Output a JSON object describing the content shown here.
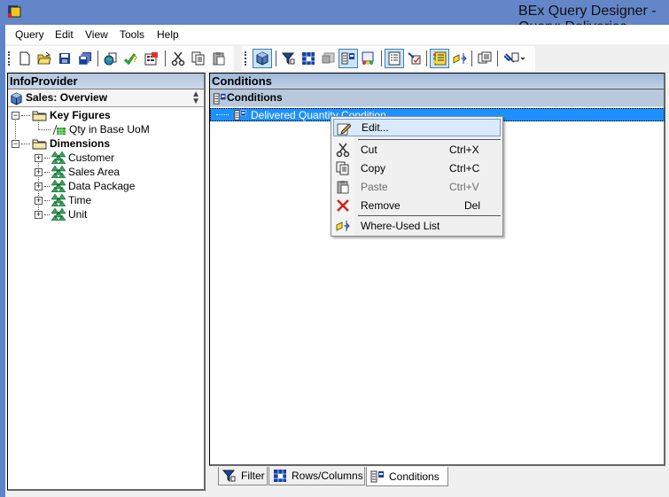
{
  "window": {
    "title": "BEx Query Designer - Query: Deliveries Report",
    "icon": "app-icon"
  },
  "menubar": {
    "items": [
      "Query",
      "Edit",
      "View",
      "Tools",
      "Help"
    ]
  },
  "toolbar1": {
    "buttons": [
      {
        "name": "new-query",
        "icon": "new-document-icon"
      },
      {
        "name": "open-query",
        "icon": "open-folder-icon"
      },
      {
        "name": "save-query",
        "icon": "save-icon"
      },
      {
        "name": "save-all",
        "icon": "save-all-icon"
      },
      {
        "name": "publish",
        "icon": "publish-web-icon"
      },
      {
        "name": "check-query",
        "icon": "check-icon"
      },
      {
        "name": "query-properties",
        "icon": "properties-icon"
      },
      {
        "name": "cut",
        "icon": "cut-icon"
      },
      {
        "name": "copy",
        "icon": "copy-icon"
      },
      {
        "name": "paste",
        "icon": "paste-icon"
      }
    ]
  },
  "toolbar2": {
    "buttons": [
      {
        "name": "infoprovider",
        "icon": "cube-icon",
        "active": true
      },
      {
        "name": "filter",
        "icon": "filter-icon",
        "active": false
      },
      {
        "name": "rows-columns",
        "icon": "grid-icon",
        "active": false
      },
      {
        "name": "cells",
        "icon": "cells-icon",
        "active": false
      },
      {
        "name": "conditions",
        "icon": "conditions-icon",
        "active": true
      },
      {
        "name": "exceptions",
        "icon": "exceptions-icon",
        "active": false
      },
      {
        "name": "properties",
        "icon": "properties-list-icon",
        "active": true
      },
      {
        "name": "tasks",
        "icon": "tasks-icon",
        "active": false
      },
      {
        "name": "messages",
        "icon": "messages-icon",
        "active": true
      },
      {
        "name": "where-used",
        "icon": "where-used-icon",
        "active": false
      },
      {
        "name": "documents",
        "icon": "documents-icon",
        "active": false
      },
      {
        "name": "tools",
        "icon": "wrench-icon",
        "active": false
      }
    ]
  },
  "left_pane": {
    "header": "InfoProvider",
    "provider": "Sales: Overview",
    "tree": [
      {
        "label": "Key Figures",
        "type": "folder",
        "expanded": true,
        "children": [
          {
            "label": "Qty in Base UoM",
            "type": "key-figure"
          }
        ]
      },
      {
        "label": "Dimensions",
        "type": "folder",
        "expanded": true,
        "children": [
          {
            "label": "Customer",
            "type": "dimension"
          },
          {
            "label": "Sales Area",
            "type": "dimension"
          },
          {
            "label": "Data Package",
            "type": "dimension"
          },
          {
            "label": "Time",
            "type": "dimension"
          },
          {
            "label": "Unit",
            "type": "dimension"
          }
        ]
      }
    ]
  },
  "right_pane": {
    "header": "Conditions",
    "group_label": "Conditions",
    "selected_item": "Delivered Quantity Condition"
  },
  "context_menu": {
    "items": [
      {
        "label": "Edit...",
        "shortcut": "",
        "icon": "edit-pencil-icon",
        "highlighted": true,
        "disabled": false
      },
      {
        "label": "Cut",
        "shortcut": "Ctrl+X",
        "icon": "cut-icon",
        "highlighted": false,
        "disabled": false
      },
      {
        "label": "Copy",
        "shortcut": "Ctrl+C",
        "icon": "copy-icon",
        "highlighted": false,
        "disabled": false
      },
      {
        "label": "Paste",
        "shortcut": "Ctrl+V",
        "icon": "paste-icon",
        "highlighted": false,
        "disabled": true
      },
      {
        "label": "Remove",
        "shortcut": "Del",
        "icon": "remove-x-icon",
        "highlighted": false,
        "disabled": false
      },
      {
        "label": "Where-Used List",
        "shortcut": "",
        "icon": "where-used-icon",
        "highlighted": false,
        "disabled": false
      }
    ]
  },
  "bottom_tabs": [
    {
      "label": "Filter",
      "icon": "filter-icon",
      "active": false
    },
    {
      "label": "Rows/Columns",
      "icon": "grid-icon",
      "active": false
    },
    {
      "label": "Conditions",
      "icon": "conditions-icon",
      "active": true
    }
  ]
}
